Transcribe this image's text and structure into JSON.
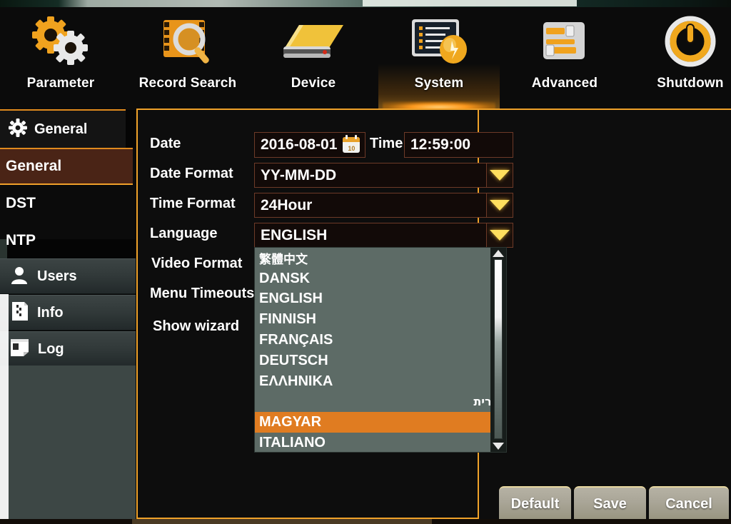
{
  "topnav": {
    "items": [
      {
        "label": "Parameter",
        "icon": "gears-icon",
        "active": false
      },
      {
        "label": "Record Search",
        "icon": "film-search-icon",
        "active": false
      },
      {
        "label": "Device",
        "icon": "harddisk-icon",
        "active": false
      },
      {
        "label": "System",
        "icon": "system-monitor-icon",
        "active": true
      },
      {
        "label": "Advanced",
        "icon": "advanced-sliders-icon",
        "active": false
      },
      {
        "label": "Shutdown",
        "icon": "power-icon",
        "active": false
      }
    ]
  },
  "sidebar": {
    "header": {
      "label": "General",
      "icon": "gear-icon"
    },
    "subitems": [
      {
        "label": "General",
        "selected": true
      },
      {
        "label": "DST",
        "selected": false
      },
      {
        "label": "NTP",
        "selected": false
      }
    ],
    "groups": [
      {
        "label": "Users",
        "icon": "user-icon"
      },
      {
        "label": "Info",
        "icon": "info-card-icon"
      },
      {
        "label": "Log",
        "icon": "log-book-icon"
      }
    ]
  },
  "form": {
    "rows": [
      {
        "label": "Date",
        "value": "2016-08-01",
        "type": "date"
      },
      {
        "label": "Date Format",
        "value": "YY-MM-DD",
        "type": "select"
      },
      {
        "label": "Time Format",
        "value": "24Hour",
        "type": "select"
      },
      {
        "label": "Language",
        "value": "ENGLISH",
        "type": "select"
      },
      {
        "label": "Video Format",
        "value": "",
        "type": "select"
      },
      {
        "label": "Menu Timeouts",
        "value": "",
        "type": "select"
      },
      {
        "label": "Show wizard",
        "value": "",
        "type": "select"
      }
    ],
    "time_label": "Time",
    "time_value": "12:59:00",
    "calendar_icon_text": "10"
  },
  "dropdown": {
    "open_for": "Language",
    "items": [
      {
        "label": "繁體中文",
        "script": "cjk",
        "selected": false
      },
      {
        "label": "DANSK",
        "script": "latin",
        "selected": false
      },
      {
        "label": "ENGLISH",
        "script": "latin",
        "selected": false
      },
      {
        "label": "FINNISH",
        "script": "latin",
        "selected": false
      },
      {
        "label": "FRANÇAIS",
        "script": "latin",
        "selected": false
      },
      {
        "label": "DEUTSCH",
        "script": "latin",
        "selected": false
      },
      {
        "label": "ΕΛΛΗΝΙΚΑ",
        "script": "latin",
        "selected": false
      },
      {
        "label": "עברית",
        "script": "hebrew",
        "selected": false
      },
      {
        "label": "MAGYAR",
        "script": "latin",
        "selected": true
      },
      {
        "label": "ITALIANO",
        "script": "latin",
        "selected": false
      }
    ],
    "scroll": {
      "up_arrow": "▲",
      "down_arrow": "▼"
    }
  },
  "buttons": [
    {
      "label": "Default"
    },
    {
      "label": "Save"
    },
    {
      "label": "Cancel"
    }
  ],
  "colors": {
    "accent_orange": "#f0a22a",
    "highlight_orange": "#e07c21",
    "panel_bg": "#0d0d0d",
    "dropdown_bg": "#5d6b66",
    "caret_yellow": "#ffdf5e",
    "selected_submenu": "#4a2416"
  }
}
